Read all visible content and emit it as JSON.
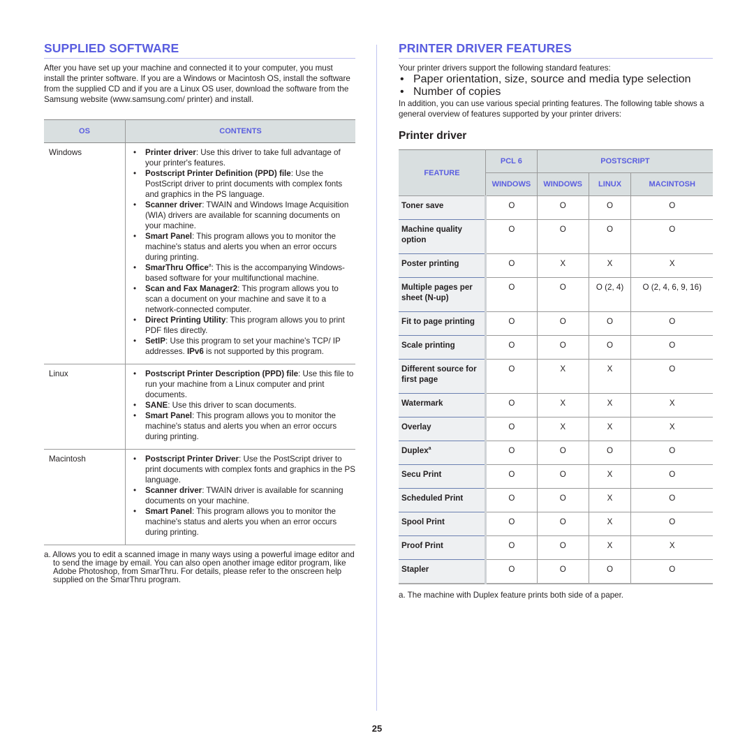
{
  "left": {
    "title": "SUPPLIED SOFTWARE",
    "intro": "After you have set up your machine and connected it to your computer, you must install the printer software. If you are a Windows or Macintosh OS, install the software from the supplied CD and if you are a Linux OS user, download the software from the Samsung website (www.samsung.com/ printer) and install.",
    "table": {
      "headers": [
        "OS",
        "CONTENTS"
      ],
      "rows": [
        {
          "os": "Windows",
          "items": [
            {
              "bold": "Printer driver",
              "text": ": Use this driver to take full advantage of your printer's features."
            },
            {
              "bold": "Postscript Printer Definition (PPD) file",
              "text": ": Use the PostScript driver to print documents with complex fonts and graphics in the PS language."
            },
            {
              "bold": "Scanner driver",
              "text": ": TWAIN and Windows Image Acquisition (WIA) drivers are available for scanning documents on your machine."
            },
            {
              "bold": "Smart Panel",
              "text": ": This program allows you to monitor the machine's status and alerts you when an error occurs during printing."
            },
            {
              "bold": "SmarThru Office",
              "sup": "a",
              "text": ": This is the accompanying Windows-based software for your multifunctional machine."
            },
            {
              "bold": "Scan and Fax Manager2",
              "text": ": This program allows you to scan a document on your machine and save it to a network-connected computer."
            },
            {
              "bold": "Direct Printing Utility",
              "text": ": This program allows you to print PDF files directly."
            },
            {
              "bold": "SetIP",
              "text": ": Use this program to set your machine's TCP/ IP addresses. ",
              "bold2": "IPv6",
              "text2": " is not supported by this program."
            }
          ]
        },
        {
          "os": "Linux",
          "items": [
            {
              "bold": "Postscript Printer Description (PPD) file",
              "text": ": Use this file to run your machine from a Linux computer and print documents."
            },
            {
              "bold": "SANE",
              "text": ": Use this driver to scan documents."
            },
            {
              "bold": "Smart Panel",
              "text": ": This program allows you to monitor the machine's status and alerts you when an error occurs during printing."
            }
          ]
        },
        {
          "os": "Macintosh",
          "items": [
            {
              "bold": "Postscript Printer Driver",
              "text": ": Use the PostScript driver to print documents with complex fonts and graphics in the PS language."
            },
            {
              "bold": "Scanner driver",
              "text": ": TWAIN driver is available for scanning documents on your machine."
            },
            {
              "bold": "Smart Panel",
              "text": ": This program allows you to monitor the machine's status and alerts you when an error occurs during printing."
            }
          ]
        }
      ]
    },
    "footnote": "a. Allows you to edit a scanned image in many ways using a powerful image editor and to send the image by email. You can also open another image editor program, like Adobe Photoshop, from SmarThru. For details, please refer to the onscreen help supplied on the SmarThru program."
  },
  "right": {
    "title": "PRINTER DRIVER FEATURES",
    "intro": "Your printer drivers support the following standard features:",
    "standard_features": [
      "Paper orientation, size, source and media type selection",
      "Number of copies"
    ],
    "intro2": "In addition, you can use various special printing features. The following table shows a general overview of features supported by your printer drivers:",
    "subtitle": "Printer driver",
    "table": {
      "feature_header": "FEATURE",
      "group_headers": [
        "PCL 6",
        "POSTSCRIPT"
      ],
      "sub_headers": [
        "WINDOWS",
        "WINDOWS",
        "LINUX",
        "MACINTOSH"
      ],
      "rows": [
        {
          "feature": "Toner save",
          "values": [
            "O",
            "O",
            "O",
            "O"
          ]
        },
        {
          "feature": "Machine quality option",
          "values": [
            "O",
            "O",
            "O",
            "O"
          ]
        },
        {
          "feature": "Poster printing",
          "values": [
            "O",
            "X",
            "X",
            "X"
          ]
        },
        {
          "feature": "Multiple pages per sheet (N-up)",
          "values": [
            "O",
            "O",
            "O (2, 4)",
            "O (2, 4, 6, 9, 16)"
          ]
        },
        {
          "feature": "Fit to page printing",
          "values": [
            "O",
            "O",
            "O",
            "O"
          ]
        },
        {
          "feature": "Scale printing",
          "values": [
            "O",
            "O",
            "O",
            "O"
          ]
        },
        {
          "feature": "Different source for first page",
          "values": [
            "O",
            "X",
            "X",
            "O"
          ]
        },
        {
          "feature": "Watermark",
          "values": [
            "O",
            "X",
            "X",
            "X"
          ]
        },
        {
          "feature": "Overlay",
          "values": [
            "O",
            "X",
            "X",
            "X"
          ]
        },
        {
          "feature": "Duplex",
          "sup": "a",
          "values": [
            "O",
            "O",
            "O",
            "O"
          ]
        },
        {
          "feature": "Secu Print",
          "values": [
            "O",
            "O",
            "X",
            "O"
          ]
        },
        {
          "feature": "Scheduled Print",
          "values": [
            "O",
            "O",
            "X",
            "O"
          ]
        },
        {
          "feature": "Spool Print",
          "values": [
            "O",
            "O",
            "X",
            "O"
          ]
        },
        {
          "feature": "Proof Print",
          "values": [
            "O",
            "O",
            "X",
            "X"
          ]
        },
        {
          "feature": "Stapler",
          "values": [
            "O",
            "O",
            "O",
            "O"
          ]
        }
      ]
    },
    "footnote": "a. The machine with Duplex feature prints both side of a paper."
  },
  "page_number": "25",
  "colors": {
    "heading": "#5a5ee0",
    "header_bg": "#d9dfe0",
    "rule": "#b9bcf0"
  }
}
